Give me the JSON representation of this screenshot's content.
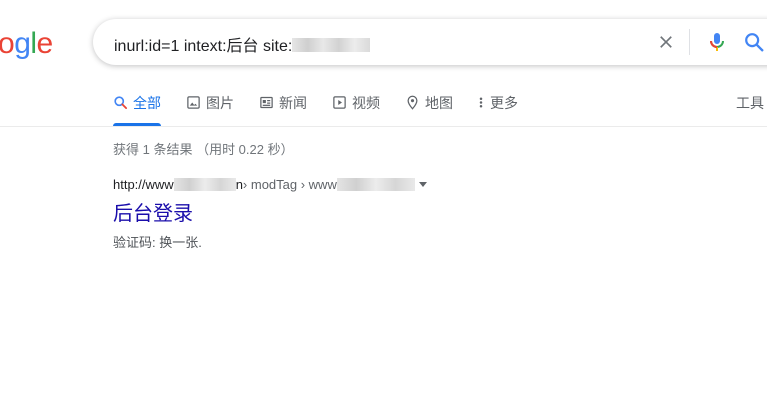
{
  "logo": {
    "letters": [
      "o",
      "g",
      "l",
      "e"
    ],
    "colors": [
      "#ea4335",
      "#4285f4",
      "#34a853",
      "#ea4335"
    ]
  },
  "search": {
    "query_prefix": "inurl:id=1  intext:后台 site:",
    "clear_icon": "close-icon",
    "mic_icon": "mic-icon",
    "search_icon": "search-icon"
  },
  "tabs": [
    {
      "label": "全部",
      "icon": "search-icon",
      "active": true
    },
    {
      "label": "图片",
      "icon": "image-icon"
    },
    {
      "label": "新闻",
      "icon": "news-icon"
    },
    {
      "label": "视频",
      "icon": "video-icon"
    },
    {
      "label": "地图",
      "icon": "map-pin-icon"
    },
    {
      "label": "更多",
      "icon": "more-vertical-icon"
    }
  ],
  "tools_label": "工具",
  "stats": "获得 1 条结果 （用时 0.22 秒）",
  "result": {
    "url_start": "http://www",
    "url_tail": "n",
    "breadcrumb_1": " › modTag › www",
    "title": "后台登录",
    "snippet": "验证码: 换一张."
  },
  "colors": {
    "accent": "#1a73e8",
    "link": "#1a0dab",
    "mic_blue": "#4285f4",
    "mic_red": "#ea4335"
  }
}
